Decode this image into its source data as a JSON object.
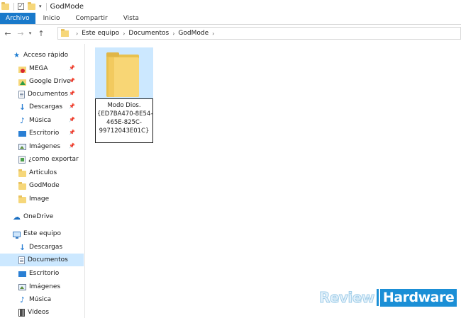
{
  "window": {
    "title": "GodMode"
  },
  "ribbon": {
    "tabs": [
      "Archivo",
      "Inicio",
      "Compartir",
      "Vista"
    ]
  },
  "address_bar": {
    "crumbs": [
      "Este equipo",
      "Documentos",
      "GodMode"
    ]
  },
  "sidebar": {
    "quick_access": "Acceso rápido",
    "quick_items": [
      "MEGA",
      "Google Drive",
      "Documentos",
      "Descargas",
      "Música",
      "Escritorio",
      "Imágenes",
      "¿como exportar",
      "Articulos",
      "GodMode",
      "Image"
    ],
    "onedrive": "OneDrive",
    "this_pc": "Este equipo",
    "pc_items": [
      "Descargas",
      "Documentos",
      "Escritorio",
      "Imágenes",
      "Música",
      "Vídeos"
    ],
    "selected_item": "Documentos"
  },
  "content": {
    "rename_lines": [
      "Modo Dios.",
      "{ED7BA470-8E54-",
      "465E-825C-",
      "99712043E01C}"
    ]
  },
  "watermark": {
    "part1": "Review",
    "part2": "Hardware"
  },
  "colors": {
    "accent": "#1979ca",
    "selection": "#cce8ff",
    "folder": "#f8d675"
  }
}
